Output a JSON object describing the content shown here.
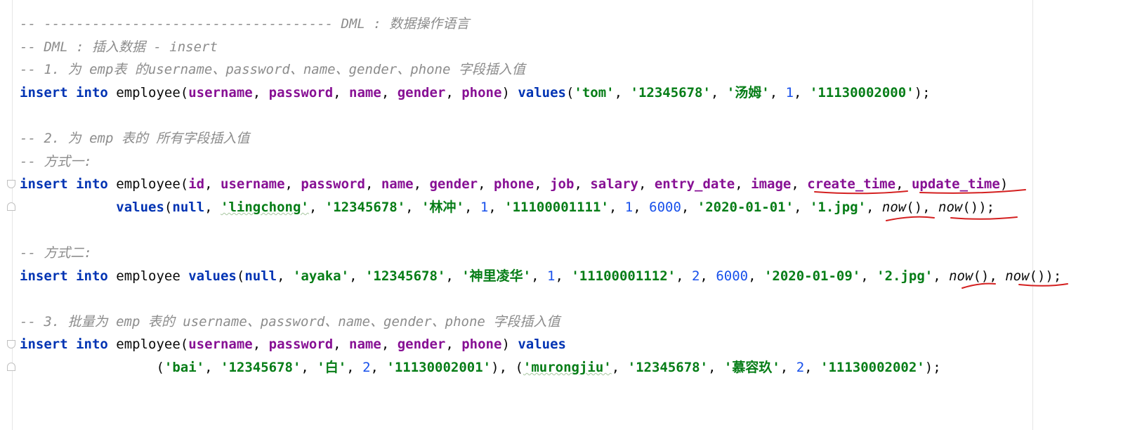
{
  "editor": {
    "lines": [
      [
        {
          "c": "c",
          "t": "-- ------------------------------------ DML : 数据操作语言"
        }
      ],
      [
        {
          "c": "c",
          "t": "-- DML : 插入数据 - insert"
        }
      ],
      [
        {
          "c": "c",
          "t": "-- 1. 为 emp表 的username、password、name、gender、phone 字段插入值"
        }
      ],
      [
        {
          "c": "k",
          "t": "insert into"
        },
        {
          "c": "t",
          "t": " employee("
        },
        {
          "c": "f",
          "t": "username"
        },
        {
          "c": "t",
          "t": ", "
        },
        {
          "c": "f",
          "t": "password"
        },
        {
          "c": "t",
          "t": ", "
        },
        {
          "c": "f",
          "t": "name"
        },
        {
          "c": "t",
          "t": ", "
        },
        {
          "c": "f",
          "t": "gender"
        },
        {
          "c": "t",
          "t": ", "
        },
        {
          "c": "f",
          "t": "phone"
        },
        {
          "c": "t",
          "t": ") "
        },
        {
          "c": "k",
          "t": "values"
        },
        {
          "c": "t",
          "t": "("
        },
        {
          "c": "s",
          "t": "'tom'"
        },
        {
          "c": "t",
          "t": ", "
        },
        {
          "c": "s",
          "t": "'12345678'"
        },
        {
          "c": "t",
          "t": ", "
        },
        {
          "c": "s",
          "t": "'汤姆'"
        },
        {
          "c": "t",
          "t": ", "
        },
        {
          "c": "n",
          "t": "1"
        },
        {
          "c": "t",
          "t": ", "
        },
        {
          "c": "s",
          "t": "'11130002000'"
        },
        {
          "c": "t",
          "t": ");"
        }
      ],
      [],
      [
        {
          "c": "c",
          "t": "-- 2. 为 emp 表的 所有字段插入值"
        }
      ],
      [
        {
          "c": "c",
          "t": "-- 方式一:"
        }
      ],
      [
        {
          "c": "k",
          "t": "insert into"
        },
        {
          "c": "t",
          "t": " employee("
        },
        {
          "c": "f",
          "t": "id"
        },
        {
          "c": "t",
          "t": ", "
        },
        {
          "c": "f",
          "t": "username"
        },
        {
          "c": "t",
          "t": ", "
        },
        {
          "c": "f",
          "t": "password"
        },
        {
          "c": "t",
          "t": ", "
        },
        {
          "c": "f",
          "t": "name"
        },
        {
          "c": "t",
          "t": ", "
        },
        {
          "c": "f",
          "t": "gender"
        },
        {
          "c": "t",
          "t": ", "
        },
        {
          "c": "f",
          "t": "phone"
        },
        {
          "c": "t",
          "t": ", "
        },
        {
          "c": "f",
          "t": "job"
        },
        {
          "c": "t",
          "t": ", "
        },
        {
          "c": "f",
          "t": "salary"
        },
        {
          "c": "t",
          "t": ", "
        },
        {
          "c": "f",
          "t": "entry_date"
        },
        {
          "c": "t",
          "t": ", "
        },
        {
          "c": "f",
          "t": "image"
        },
        {
          "c": "t",
          "t": ", "
        },
        {
          "c": "f",
          "t": "create_time"
        },
        {
          "c": "t",
          "t": ", "
        },
        {
          "c": "f",
          "t": "update_time"
        },
        {
          "c": "t",
          "t": ")"
        }
      ],
      [
        {
          "c": "t",
          "t": "            "
        },
        {
          "c": "k",
          "t": "values"
        },
        {
          "c": "t",
          "t": "("
        },
        {
          "c": "k",
          "t": "null"
        },
        {
          "c": "t",
          "t": ", "
        },
        {
          "c": "s sq",
          "t": "'lingchong'"
        },
        {
          "c": "t",
          "t": ", "
        },
        {
          "c": "s",
          "t": "'12345678'"
        },
        {
          "c": "t",
          "t": ", "
        },
        {
          "c": "s",
          "t": "'林冲'"
        },
        {
          "c": "t",
          "t": ", "
        },
        {
          "c": "n",
          "t": "1"
        },
        {
          "c": "t",
          "t": ", "
        },
        {
          "c": "s",
          "t": "'11100001111'"
        },
        {
          "c": "t",
          "t": ", "
        },
        {
          "c": "n",
          "t": "1"
        },
        {
          "c": "t",
          "t": ", "
        },
        {
          "c": "n",
          "t": "6000"
        },
        {
          "c": "t",
          "t": ", "
        },
        {
          "c": "s",
          "t": "'2020-01-01'"
        },
        {
          "c": "t",
          "t": ", "
        },
        {
          "c": "s",
          "t": "'1.jpg'"
        },
        {
          "c": "t",
          "t": ", "
        },
        {
          "c": "fn",
          "t": "now"
        },
        {
          "c": "t",
          "t": "(), "
        },
        {
          "c": "fn",
          "t": "now"
        },
        {
          "c": "t",
          "t": "());"
        }
      ],
      [],
      [
        {
          "c": "c",
          "t": "-- 方式二:"
        }
      ],
      [
        {
          "c": "k",
          "t": "insert into"
        },
        {
          "c": "t",
          "t": " employee "
        },
        {
          "c": "k",
          "t": "values"
        },
        {
          "c": "t",
          "t": "("
        },
        {
          "c": "k",
          "t": "null"
        },
        {
          "c": "t",
          "t": ", "
        },
        {
          "c": "s",
          "t": "'ayaka'"
        },
        {
          "c": "t",
          "t": ", "
        },
        {
          "c": "s",
          "t": "'12345678'"
        },
        {
          "c": "t",
          "t": ", "
        },
        {
          "c": "s",
          "t": "'神里凌华'"
        },
        {
          "c": "t",
          "t": ", "
        },
        {
          "c": "n",
          "t": "1"
        },
        {
          "c": "t",
          "t": ", "
        },
        {
          "c": "s",
          "t": "'11100001112'"
        },
        {
          "c": "t",
          "t": ", "
        },
        {
          "c": "n",
          "t": "2"
        },
        {
          "c": "t",
          "t": ", "
        },
        {
          "c": "n",
          "t": "6000"
        },
        {
          "c": "t",
          "t": ", "
        },
        {
          "c": "s",
          "t": "'2020-01-09'"
        },
        {
          "c": "t",
          "t": ", "
        },
        {
          "c": "s",
          "t": "'2.jpg'"
        },
        {
          "c": "t",
          "t": ", "
        },
        {
          "c": "fn",
          "t": "now"
        },
        {
          "c": "t",
          "t": "(), "
        },
        {
          "c": "fn",
          "t": "now"
        },
        {
          "c": "t",
          "t": "());"
        }
      ],
      [],
      [
        {
          "c": "c",
          "t": "-- 3. 批量为 emp 表的 username、password、name、gender、phone 字段插入值"
        }
      ],
      [
        {
          "c": "k",
          "t": "insert into"
        },
        {
          "c": "t",
          "t": " employee("
        },
        {
          "c": "f",
          "t": "username"
        },
        {
          "c": "t",
          "t": ", "
        },
        {
          "c": "f",
          "t": "password"
        },
        {
          "c": "t",
          "t": ", "
        },
        {
          "c": "f",
          "t": "name"
        },
        {
          "c": "t",
          "t": ", "
        },
        {
          "c": "f",
          "t": "gender"
        },
        {
          "c": "t",
          "t": ", "
        },
        {
          "c": "f",
          "t": "phone"
        },
        {
          "c": "t",
          "t": ") "
        },
        {
          "c": "k",
          "t": "values"
        }
      ],
      [
        {
          "c": "t",
          "t": "                 ("
        },
        {
          "c": "s",
          "t": "'bai'"
        },
        {
          "c": "t",
          "t": ", "
        },
        {
          "c": "s",
          "t": "'12345678'"
        },
        {
          "c": "t",
          "t": ", "
        },
        {
          "c": "s",
          "t": "'白'"
        },
        {
          "c": "t",
          "t": ", "
        },
        {
          "c": "n",
          "t": "2"
        },
        {
          "c": "t",
          "t": ", "
        },
        {
          "c": "s",
          "t": "'11130002001'"
        },
        {
          "c": "t",
          "t": "), ("
        },
        {
          "c": "s sq",
          "t": "'murongjiu'"
        },
        {
          "c": "t",
          "t": ", "
        },
        {
          "c": "s",
          "t": "'12345678'"
        },
        {
          "c": "t",
          "t": ", "
        },
        {
          "c": "s",
          "t": "'慕容玖'"
        },
        {
          "c": "t",
          "t": ", "
        },
        {
          "c": "n",
          "t": "2"
        },
        {
          "c": "t",
          "t": ", "
        },
        {
          "c": "s",
          "t": "'11130002002'"
        },
        {
          "c": "t",
          "t": ");"
        }
      ]
    ]
  },
  "icons": {
    "fold_marker": "fold-marker-icon"
  },
  "colors": {
    "keyword": "#0033b3",
    "field": "#871094",
    "string": "#067d17",
    "number": "#1750eb",
    "comment": "#8c8c8c",
    "annotation_ink": "#d42020"
  }
}
